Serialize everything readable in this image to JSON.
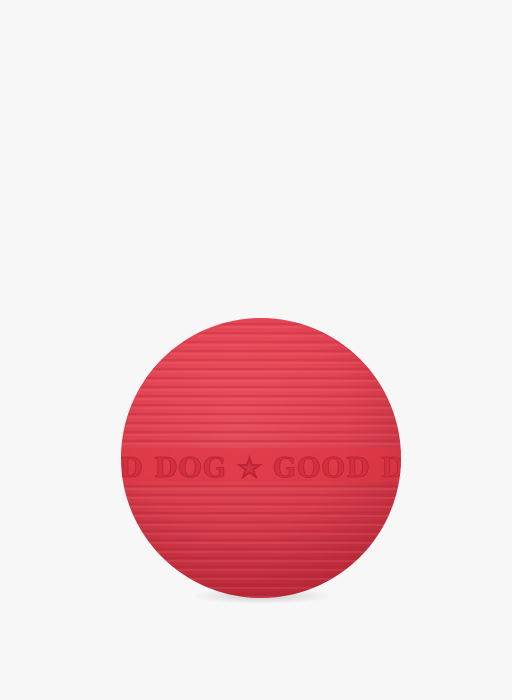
{
  "product": {
    "engraving": "GOOD DOG",
    "engraving_separator": "★",
    "engraving_text": "OOD DOG ★ GOOD DOG",
    "ball_color": "#e8394a",
    "background_color": "#f7f7f7"
  }
}
